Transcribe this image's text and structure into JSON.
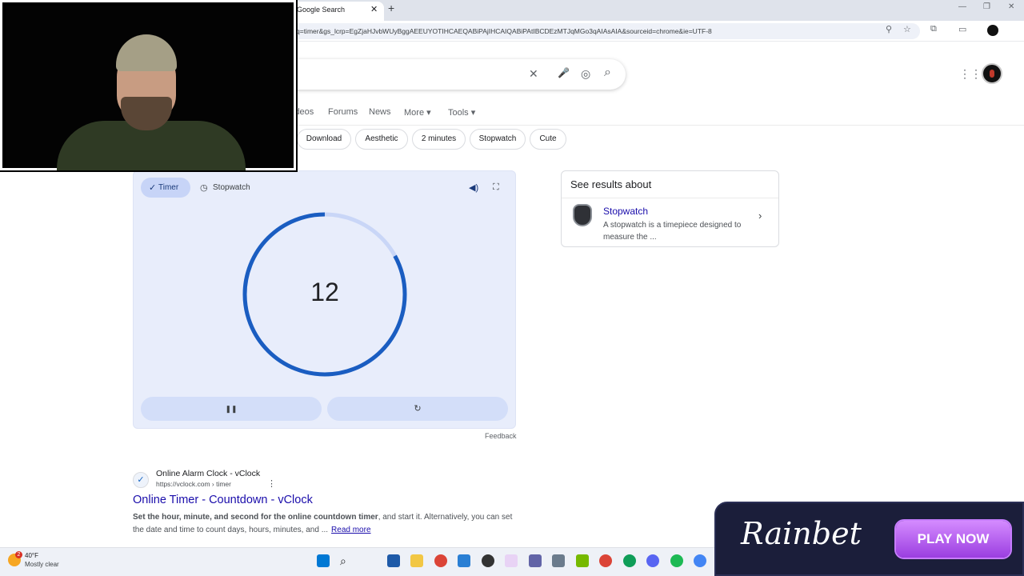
{
  "browser": {
    "tab_title": "Google Search",
    "tab_close": "✕",
    "new_tab": "+",
    "url": "q=timer&gs_lcrp=EgZjaHJvbWUyBggAEEUYOTIHCAEQABiPAjIHCAIQABiPAtIBCDEzMTJqMGo3qAIAsAIA&sourceid=chrome&ie=UTF-8",
    "window_controls": [
      "—",
      "❐",
      "✕"
    ],
    "toolbar_icons": [
      "⚲",
      "☆",
      "⧉",
      "▭"
    ]
  },
  "search": {
    "clear_icon": "✕",
    "mic_icon": "🎤",
    "lens_icon": "◎",
    "search_icon": "⌕",
    "apps_icon": "⋮⋮⋮"
  },
  "nav": {
    "videos": "ideos",
    "forums": "Forums",
    "news": "News",
    "more": "More ▾",
    "tools": "Tools ▾"
  },
  "chips": [
    "Download",
    "Aesthetic",
    "2 minutes",
    "Stopwatch",
    "Cute"
  ],
  "timer": {
    "timer_tab": "Timer",
    "stopwatch_tab": "Stopwatch",
    "value": "12",
    "progress_fraction": 0.83,
    "pause_icon": "❚❚",
    "reset_icon": "↻",
    "feedback": "Feedback",
    "accent": "#1a5dc1",
    "track": "#c9d6f7"
  },
  "knowledge_panel": {
    "heading": "See results about",
    "link": "Stopwatch",
    "description": "A stopwatch is a timepiece designed to measure the ...",
    "chevron": "›"
  },
  "result": {
    "favicon": "✓",
    "site": "Online Alarm Clock - vClock",
    "url": "https://vclock.com › timer",
    "more": "⋮",
    "title": "Online Timer - Countdown - vClock",
    "snippet_bold": "Set the hour, minute, and second for the online countdown timer",
    "snippet_rest": ", and start it. Alternatively, you can set the date and time to count days, hours, minutes, and ...",
    "read_more": "Read more"
  },
  "ad": {
    "brand": "Rainbet",
    "cta": "PLAY NOW"
  },
  "taskbar": {
    "weather_badge": "2",
    "temperature": "40°F",
    "condition": "Mostly clear"
  }
}
